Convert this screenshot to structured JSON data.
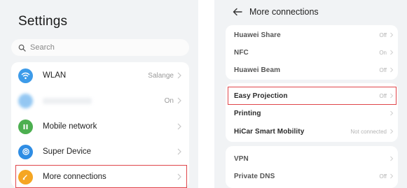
{
  "left": {
    "title": "Settings",
    "search": {
      "placeholder": "Search"
    },
    "items": [
      {
        "label": "WLAN",
        "value": "Salange",
        "icon": "wifi-icon",
        "color": "#3d9be9"
      },
      {
        "label": "",
        "value": "On",
        "icon": "bluetooth-icon",
        "color": "#3d9be9"
      },
      {
        "label": "Mobile network",
        "value": "",
        "icon": "mobile-network-icon",
        "color": "#4caf50"
      },
      {
        "label": "Super Device",
        "value": "",
        "icon": "super-device-icon",
        "color": "#2f8de4"
      },
      {
        "label": "More connections",
        "value": "",
        "icon": "link-icon",
        "color": "#f5a623"
      }
    ]
  },
  "right": {
    "title": "More connections",
    "group1": [
      {
        "label": "Huawei Share",
        "value": "Off"
      },
      {
        "label": "NFC",
        "value": "On"
      },
      {
        "label": "Huawei Beam",
        "value": "Off"
      }
    ],
    "group2": [
      {
        "label": "Easy Projection",
        "value": "Off"
      },
      {
        "label": "Printing",
        "value": ""
      },
      {
        "label": "HiCar Smart Mobility",
        "value": "Not connected"
      }
    ],
    "group3": [
      {
        "label": "VPN",
        "value": ""
      },
      {
        "label": "Private DNS",
        "value": "Off"
      }
    ]
  },
  "colors": {
    "highlight": "#e0454a",
    "background": "#f1f3f5"
  }
}
